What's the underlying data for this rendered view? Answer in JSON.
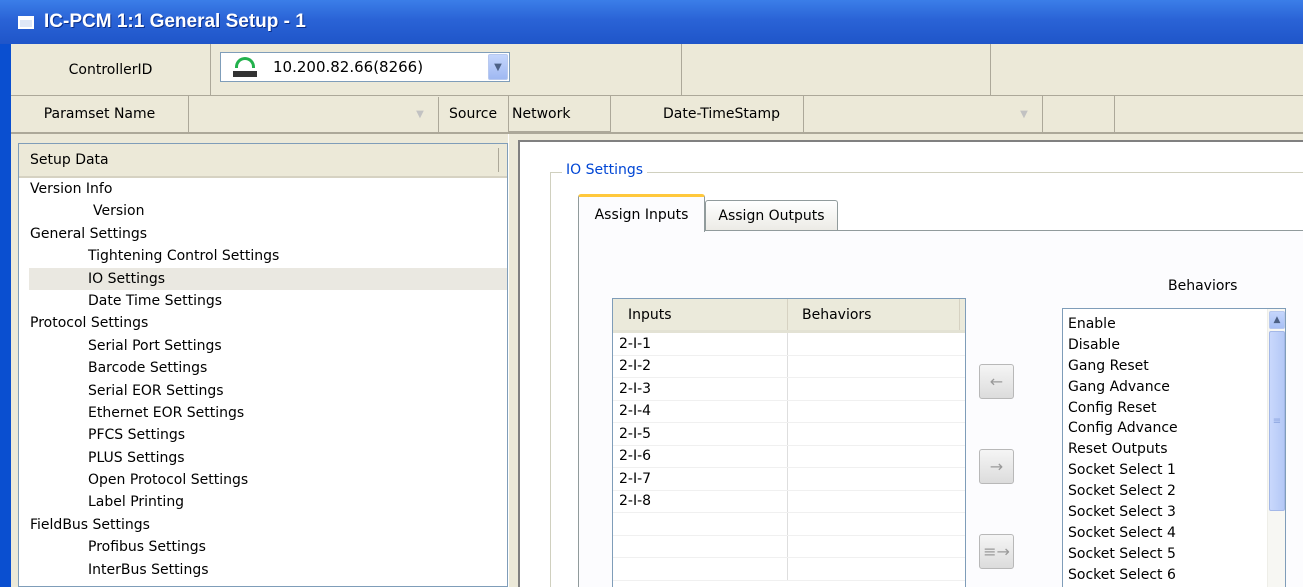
{
  "window": {
    "title": "IC-PCM 1:1 General Setup - 1"
  },
  "controller": {
    "label": "ControllerID",
    "value": "10.200.82.66(8266)"
  },
  "paramset": {
    "name_label": "Paramset Name",
    "source_label": "Source",
    "source_value": "Network",
    "datetime_label": "Date-TimeStamp"
  },
  "tree": {
    "header": "Setup Data",
    "items": [
      {
        "label": "Version Info",
        "level": 0
      },
      {
        "label": "Version",
        "level": 1
      },
      {
        "label": "General Settings",
        "level": 0
      },
      {
        "label": "Tightening Control Settings",
        "level": 1
      },
      {
        "label": "IO Settings",
        "level": 1,
        "selected": true
      },
      {
        "label": "Date Time Settings",
        "level": 1
      },
      {
        "label": "Protocol Settings",
        "level": 0
      },
      {
        "label": "Serial Port Settings",
        "level": 1
      },
      {
        "label": "Barcode Settings",
        "level": 1
      },
      {
        "label": "Serial EOR Settings",
        "level": 1
      },
      {
        "label": "Ethernet EOR Settings",
        "level": 1
      },
      {
        "label": "PFCS Settings",
        "level": 1
      },
      {
        "label": "PLUS Settings",
        "level": 1
      },
      {
        "label": "Open Protocol Settings",
        "level": 1
      },
      {
        "label": "Label Printing",
        "level": 1
      },
      {
        "label": "FieldBus Settings",
        "level": 0
      },
      {
        "label": "Profibus Settings",
        "level": 1
      },
      {
        "label": "InterBus Settings",
        "level": 1
      }
    ]
  },
  "io_settings": {
    "group_label": "IO Settings",
    "tabs": [
      "Assign Inputs",
      "Assign Outputs"
    ],
    "active_tab": "Assign Inputs",
    "table": {
      "columns": [
        "Inputs",
        "Behaviors"
      ],
      "rows": [
        [
          "2-I-1",
          ""
        ],
        [
          "2-I-2",
          ""
        ],
        [
          "2-I-3",
          ""
        ],
        [
          "2-I-4",
          ""
        ],
        [
          "2-I-5",
          ""
        ],
        [
          "2-I-6",
          ""
        ],
        [
          "2-I-7",
          ""
        ],
        [
          "2-I-8",
          ""
        ]
      ]
    },
    "behaviors_title": "Behaviors",
    "behaviors": [
      "Enable",
      "Disable",
      "Gang Reset",
      "Gang Advance",
      "Config Reset",
      "Config Advance",
      "Reset Outputs",
      "Socket Select 1",
      "Socket Select 2",
      "Socket Select 3",
      "Socket Select 4",
      "Socket Select 5",
      "Socket Select 6"
    ],
    "buttons": [
      {
        "icon": "arrow-left-icon",
        "glyph": "←"
      },
      {
        "icon": "arrow-right-icon",
        "glyph": "→"
      },
      {
        "icon": "assign-all-right-icon",
        "glyph": "≡→"
      }
    ]
  },
  "colors": {
    "titlebar": "#2a63d6",
    "accent_label": "#0046d5",
    "tab_highlight": "#ffc83c",
    "network_icon": "#22b14c"
  }
}
